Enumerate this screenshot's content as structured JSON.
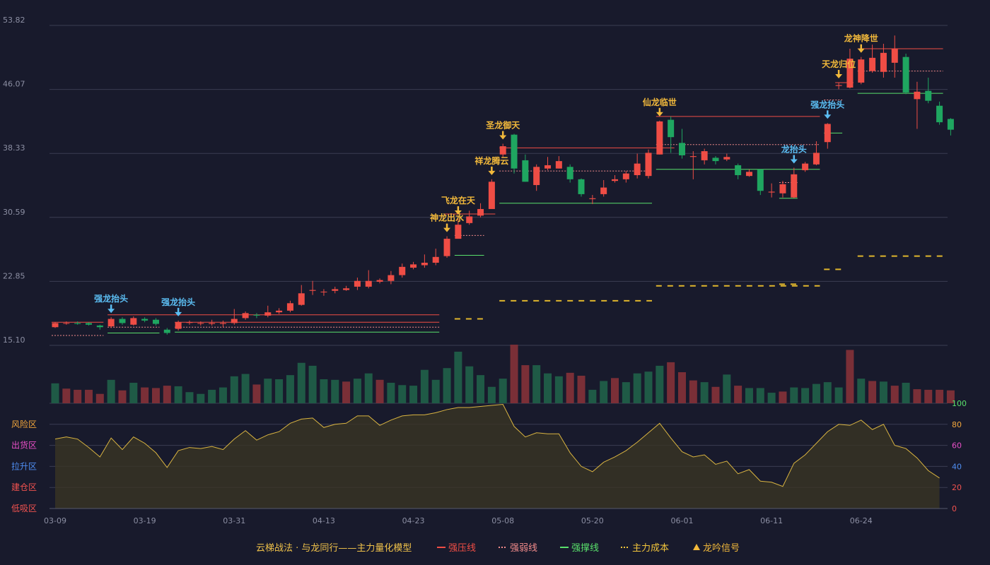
{
  "chart_data": {
    "type": "candlestick",
    "price_axis": {
      "ticks": [
        "53.82",
        "46.07",
        "38.33",
        "30.59",
        "22.85",
        "15.10"
      ],
      "ylim": [
        15.1,
        53.82
      ]
    },
    "x_ticks": [
      {
        "label": "03-09",
        "index": 0
      },
      {
        "label": "03-19",
        "index": 8
      },
      {
        "label": "03-31",
        "index": 16
      },
      {
        "label": "04-13",
        "index": 24
      },
      {
        "label": "04-23",
        "index": 32
      },
      {
        "label": "05-08",
        "index": 40
      },
      {
        "label": "05-20",
        "index": 48
      },
      {
        "label": "06-01",
        "index": 56
      },
      {
        "label": "06-11",
        "index": 64
      },
      {
        "label": "06-24",
        "index": 72
      }
    ],
    "candles": [
      [
        17.3,
        17.8,
        17.9,
        17.2
      ],
      [
        17.8,
        17.8,
        18.0,
        17.6
      ],
      [
        17.8,
        17.7,
        18.0,
        17.6
      ],
      [
        17.8,
        17.6,
        17.9,
        17.5
      ],
      [
        17.5,
        17.3,
        17.6,
        17.0
      ],
      [
        17.4,
        18.3,
        18.5,
        17.2
      ],
      [
        18.3,
        17.8,
        18.5,
        17.6
      ],
      [
        17.6,
        18.4,
        18.6,
        17.5
      ],
      [
        18.3,
        18.1,
        18.5,
        17.9
      ],
      [
        18.2,
        17.7,
        18.4,
        17.5
      ],
      [
        17.0,
        16.6,
        17.2,
        16.4
      ],
      [
        17.1,
        17.9,
        18.1,
        16.9
      ],
      [
        17.9,
        17.9,
        18.1,
        17.6
      ],
      [
        17.8,
        17.8,
        18.0,
        17.5
      ],
      [
        17.7,
        17.8,
        18.2,
        17.5
      ],
      [
        17.7,
        17.8,
        18.1,
        17.3
      ],
      [
        17.8,
        18.3,
        19.5,
        17.6
      ],
      [
        18.4,
        19.0,
        19.2,
        18.2
      ],
      [
        18.8,
        18.7,
        19.0,
        18.4
      ],
      [
        18.7,
        19.1,
        19.9,
        18.5
      ],
      [
        19.1,
        19.3,
        19.6,
        18.9
      ],
      [
        19.3,
        20.2,
        20.5,
        19.1
      ],
      [
        20.0,
        21.4,
        22.4,
        19.9
      ],
      [
        21.7,
        21.8,
        22.9,
        21.2
      ],
      [
        21.6,
        21.6,
        21.9,
        21.1
      ],
      [
        21.7,
        21.9,
        22.2,
        21.4
      ],
      [
        21.8,
        22.0,
        22.3,
        21.7
      ],
      [
        22.2,
        22.9,
        23.3,
        21.8
      ],
      [
        22.2,
        22.9,
        24.2,
        22.0
      ],
      [
        22.8,
        23.0,
        23.2,
        22.6
      ],
      [
        22.9,
        23.6,
        24.1,
        22.5
      ],
      [
        23.6,
        24.6,
        25.0,
        23.3
      ],
      [
        24.5,
        24.9,
        25.2,
        24.3
      ],
      [
        24.8,
        25.1,
        26.1,
        24.5
      ],
      [
        25.1,
        25.8,
        26.8,
        24.8
      ],
      [
        25.9,
        28.0,
        28.3,
        25.7
      ],
      [
        28.0,
        29.7,
        30.4,
        28.1
      ],
      [
        29.9,
        30.7,
        31.4,
        29.7
      ],
      [
        30.8,
        31.6,
        32.3,
        30.6
      ],
      [
        31.6,
        34.9,
        35.2,
        31.7
      ],
      [
        38.2,
        39.2,
        39.5,
        37.9
      ],
      [
        40.6,
        36.5,
        40.7,
        35.9
      ],
      [
        37.5,
        34.9,
        38.2,
        34.9
      ],
      [
        34.5,
        36.7,
        37.0,
        33.8
      ],
      [
        36.5,
        36.9,
        37.9,
        36.3
      ],
      [
        36.5,
        37.4,
        38.0,
        36.5
      ],
      [
        36.7,
        35.2,
        37.0,
        34.8
      ],
      [
        35.2,
        33.4,
        35.3,
        33.1
      ],
      [
        32.8,
        32.9,
        33.3,
        32.2
      ],
      [
        33.4,
        34.2,
        35.1,
        33.1
      ],
      [
        35.0,
        35.2,
        35.7,
        34.8
      ],
      [
        35.2,
        35.9,
        36.2,
        34.8
      ],
      [
        35.7,
        37.1,
        38.3,
        35.3
      ],
      [
        35.6,
        38.4,
        38.8,
        35.3
      ],
      [
        38.2,
        42.2,
        42.3,
        38.2
      ],
      [
        42.4,
        40.3,
        42.8,
        38.4
      ],
      [
        39.6,
        38.1,
        41.3,
        37.7
      ],
      [
        37.9,
        38.0,
        38.6,
        35.2
      ],
      [
        37.5,
        38.6,
        38.9,
        37.0
      ],
      [
        37.8,
        37.4,
        38.0,
        37.0
      ],
      [
        37.6,
        37.9,
        38.3,
        37.4
      ],
      [
        36.9,
        35.7,
        37.1,
        35.2
      ],
      [
        35.6,
        36.1,
        36.4,
        35.5
      ],
      [
        36.4,
        33.8,
        36.4,
        33.3
      ],
      [
        33.6,
        33.7,
        34.7,
        33.0
      ],
      [
        33.5,
        34.6,
        35.0,
        33.0
      ],
      [
        33.0,
        35.8,
        36.6,
        32.9
      ],
      [
        36.3,
        37.1,
        37.3,
        36.1
      ],
      [
        37.0,
        38.4,
        39.8,
        36.9
      ],
      [
        39.7,
        41.9,
        42.0,
        38.9
      ],
      [
        46.5,
        46.6,
        46.9,
        46.1
      ],
      [
        46.3,
        49.8,
        51.0,
        46.2
      ],
      [
        46.9,
        49.7,
        50.0,
        46.7
      ],
      [
        48.3,
        49.9,
        51.5,
        48.1
      ],
      [
        48.2,
        50.5,
        51.6,
        47.5
      ],
      [
        49.3,
        51.0,
        52.6,
        47.5
      ],
      [
        50.0,
        45.7,
        50.4,
        45.5
      ],
      [
        44.9,
        45.8,
        47.0,
        41.3
      ],
      [
        45.9,
        44.7,
        47.5,
        44.4
      ],
      [
        44.1,
        42.1,
        44.6,
        41.8
      ],
      [
        42.5,
        41.2,
        42.6,
        40.5
      ]
    ],
    "volume": [
      [
        0.34,
        1
      ],
      [
        0.25,
        0
      ],
      [
        0.23,
        0
      ],
      [
        0.23,
        0
      ],
      [
        0.16,
        0
      ],
      [
        0.4,
        1
      ],
      [
        0.22,
        0
      ],
      [
        0.35,
        1
      ],
      [
        0.27,
        0
      ],
      [
        0.26,
        0
      ],
      [
        0.3,
        0
      ],
      [
        0.29,
        1
      ],
      [
        0.19,
        1
      ],
      [
        0.16,
        1
      ],
      [
        0.23,
        1
      ],
      [
        0.27,
        1
      ],
      [
        0.46,
        1
      ],
      [
        0.5,
        1
      ],
      [
        0.32,
        0
      ],
      [
        0.42,
        1
      ],
      [
        0.41,
        1
      ],
      [
        0.48,
        1
      ],
      [
        0.69,
        1
      ],
      [
        0.64,
        1
      ],
      [
        0.41,
        1
      ],
      [
        0.4,
        1
      ],
      [
        0.37,
        0
      ],
      [
        0.42,
        1
      ],
      [
        0.51,
        1
      ],
      [
        0.4,
        0
      ],
      [
        0.35,
        1
      ],
      [
        0.31,
        1
      ],
      [
        0.3,
        1
      ],
      [
        0.57,
        1
      ],
      [
        0.4,
        1
      ],
      [
        0.6,
        1
      ],
      [
        0.88,
        1
      ],
      [
        0.63,
        1
      ],
      [
        0.48,
        1
      ],
      [
        0.28,
        1
      ],
      [
        0.42,
        1
      ],
      [
        1.0,
        0
      ],
      [
        0.65,
        0
      ],
      [
        0.65,
        1
      ],
      [
        0.51,
        1
      ],
      [
        0.46,
        1
      ],
      [
        0.52,
        0
      ],
      [
        0.47,
        0
      ],
      [
        0.23,
        1
      ],
      [
        0.38,
        1
      ],
      [
        0.43,
        0
      ],
      [
        0.36,
        1
      ],
      [
        0.51,
        1
      ],
      [
        0.54,
        1
      ],
      [
        0.64,
        1
      ],
      [
        0.7,
        0
      ],
      [
        0.53,
        0
      ],
      [
        0.39,
        0
      ],
      [
        0.36,
        1
      ],
      [
        0.28,
        0
      ],
      [
        0.49,
        1
      ],
      [
        0.3,
        0
      ],
      [
        0.26,
        1
      ],
      [
        0.26,
        1
      ],
      [
        0.18,
        1
      ],
      [
        0.2,
        0
      ],
      [
        0.27,
        1
      ],
      [
        0.26,
        1
      ],
      [
        0.33,
        1
      ],
      [
        0.36,
        1
      ],
      [
        0.27,
        1
      ],
      [
        0.91,
        0
      ],
      [
        0.42,
        1
      ],
      [
        0.38,
        0
      ],
      [
        0.37,
        1
      ],
      [
        0.3,
        0
      ],
      [
        0.35,
        1
      ],
      [
        0.24,
        0
      ],
      [
        0.23,
        0
      ],
      [
        0.23,
        0
      ],
      [
        0.22,
        0
      ]
    ],
    "oscillator": {
      "ticks": [
        "100",
        "80",
        "60",
        "40",
        "20",
        "0"
      ],
      "zones": [
        "风险区",
        "出货区",
        "拉升区",
        "建仓区",
        "低吸区"
      ],
      "values": [
        66,
        68,
        66,
        58,
        49,
        67,
        56,
        68,
        62,
        53,
        39,
        55,
        58,
        57,
        59,
        56,
        66,
        74,
        65,
        70,
        73,
        81,
        85,
        86,
        77,
        80,
        81,
        88,
        88,
        79,
        84,
        88,
        89,
        89,
        91,
        94,
        96,
        96,
        97,
        98,
        99,
        78,
        68,
        72,
        71,
        71,
        53,
        40,
        35,
        44,
        49,
        55,
        63,
        72,
        81,
        67,
        54,
        49,
        51,
        42,
        45,
        33,
        37,
        26,
        25,
        21,
        43,
        51,
        62,
        73,
        80,
        79,
        84,
        75,
        80,
        60,
        57,
        48,
        36,
        29
      ]
    },
    "lines": {
      "strong_pressure": [
        [
          0,
          4,
          17.9
        ],
        [
          5,
          34,
          18.8
        ],
        [
          11,
          34,
          17.9
        ],
        [
          35,
          39,
          31.0
        ],
        [
          40,
          55,
          39.0
        ],
        [
          54,
          68,
          42.8
        ],
        [
          70,
          71,
          46.9
        ],
        [
          72,
          79,
          51.0
        ]
      ],
      "strong_weak": [
        [
          0,
          4,
          16.3
        ],
        [
          5,
          9,
          17.3
        ],
        [
          11,
          34,
          17.3
        ],
        [
          36,
          38,
          28.4
        ],
        [
          40,
          53,
          36.2
        ],
        [
          54,
          68,
          39.4
        ],
        [
          65,
          66,
          34.8
        ],
        [
          69,
          70,
          44.8
        ],
        [
          72,
          79,
          48.3
        ]
      ],
      "strong_support": [
        [
          5,
          9,
          16.6
        ],
        [
          11,
          34,
          16.7
        ],
        [
          36,
          38,
          26.0
        ],
        [
          40,
          53,
          32.3
        ],
        [
          54,
          68,
          36.4
        ],
        [
          65,
          66,
          32.9
        ],
        [
          69,
          70,
          40.8
        ],
        [
          72,
          79,
          45.6
        ]
      ],
      "main_cost": [
        [
          36,
          38,
          18.3
        ],
        [
          40,
          53,
          20.5
        ],
        [
          54,
          68,
          22.3
        ],
        [
          65,
          66,
          22.5
        ],
        [
          69,
          70,
          24.3
        ],
        [
          72,
          79,
          25.9
        ]
      ]
    },
    "signals": [
      {
        "index": 5,
        "label": "强龙抬头",
        "color": "#5bbdf2"
      },
      {
        "index": 11,
        "label": "强龙抬头",
        "color": "#5bbdf2"
      },
      {
        "index": 35,
        "label": "神龙出水",
        "color": "#f2b93b"
      },
      {
        "index": 36,
        "label": "飞龙在天",
        "color": "#f2b93b"
      },
      {
        "index": 39,
        "label": "祥龙腾云",
        "color": "#f2b93b"
      },
      {
        "index": 40,
        "label": "圣龙御天",
        "color": "#f2b93b"
      },
      {
        "index": 54,
        "label": "仙龙临世",
        "color": "#f2b93b"
      },
      {
        "index": 66,
        "label": "龙抬头",
        "color": "#5bbdf2"
      },
      {
        "index": 69,
        "label": "强龙抬头",
        "color": "#5bbdf2"
      },
      {
        "index": 70,
        "label": "天龙归位",
        "color": "#f2b93b"
      },
      {
        "index": 72,
        "label": "龙神降世",
        "color": "#f2b93b"
      }
    ],
    "legend": {
      "title": "云梯战法 · 与龙同行——主力量化模型",
      "items": [
        {
          "label": "强压线",
          "symbol": "solid",
          "color": "#ef4d45"
        },
        {
          "label": "强弱线",
          "symbol": "dashed",
          "color": "#f28b8b"
        },
        {
          "label": "强撑线",
          "symbol": "solid",
          "color": "#59e06b"
        },
        {
          "label": "主力成本",
          "symbol": "dashed",
          "color": "#f2c53b"
        },
        {
          "label": "龙吟信号",
          "symbol": "triangle",
          "color": "#f2b93b"
        }
      ]
    },
    "colors": {
      "up": "#ef4d45",
      "down": "#1fa660",
      "vol_up": "#7a2f37",
      "vol_down": "#1f5a46",
      "osc_line": "#d9b441",
      "zone_risk": "#f2a63b",
      "zone_sell": "#e84fc7",
      "zone_rise": "#4f8ef2",
      "zone_build": "#f2524f",
      "zone_low": "#f2524f"
    }
  }
}
